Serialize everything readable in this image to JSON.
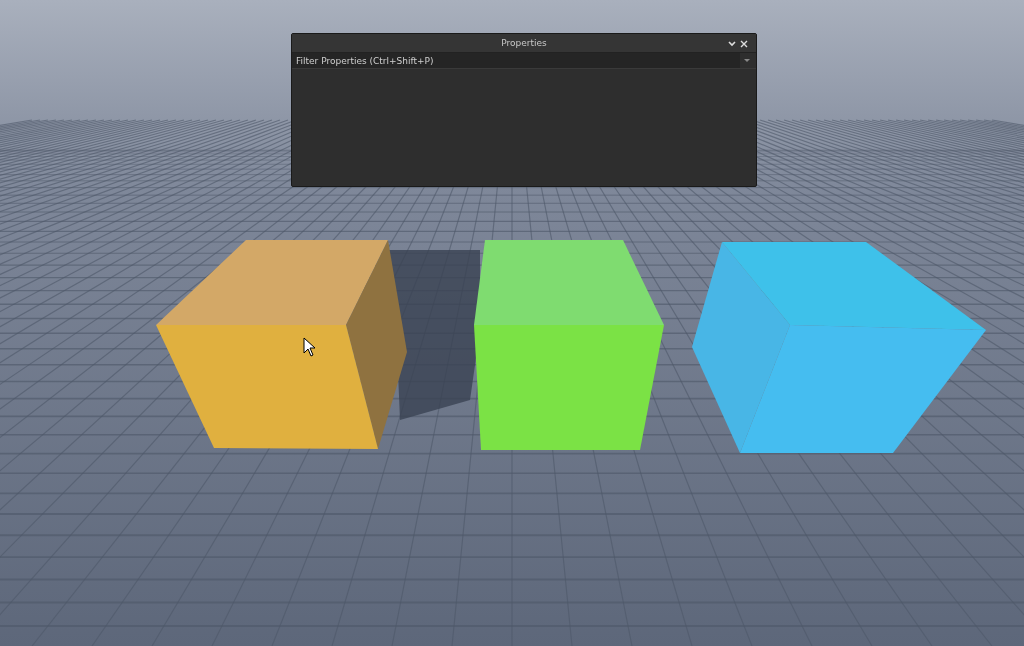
{
  "properties_panel": {
    "title": "Properties",
    "filter": {
      "placeholder": "Filter Properties (Ctrl+Shift+P)"
    }
  }
}
